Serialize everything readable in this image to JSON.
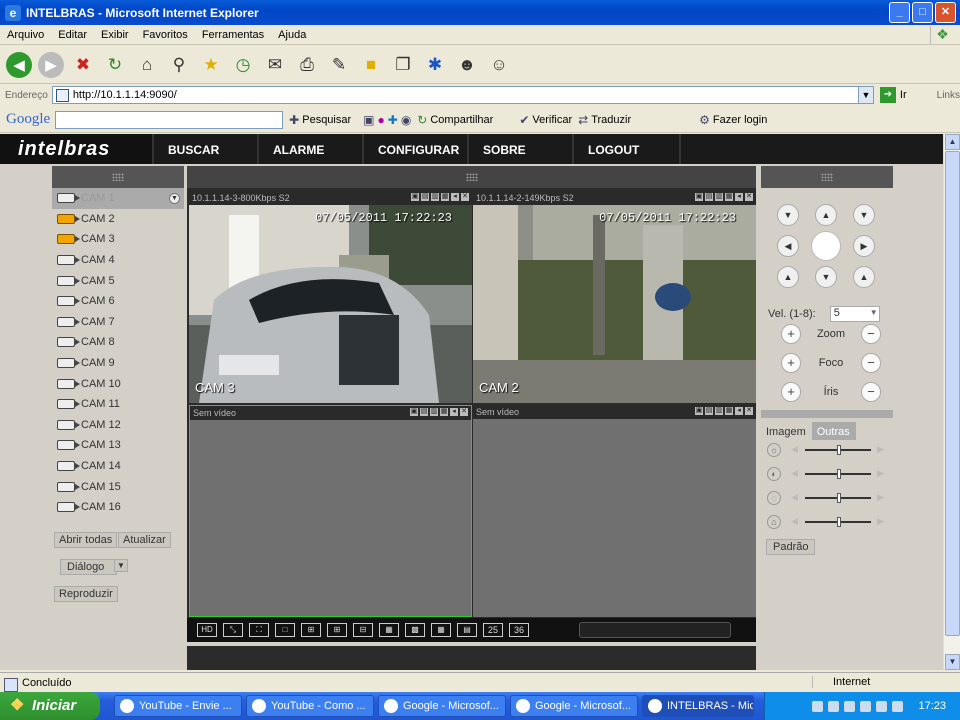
{
  "window": {
    "title": "INTELBRAS - Microsoft Internet Explorer"
  },
  "menu": [
    "Arquivo",
    "Editar",
    "Exibir",
    "Favoritos",
    "Ferramentas",
    "Ajuda"
  ],
  "address": {
    "label": "Endereço",
    "url": "http://10.1.1.14:9090/",
    "go": "Ir",
    "links": "Links"
  },
  "google": {
    "logo": "Google",
    "buttons": [
      "Pesquisar",
      "Compartilhar",
      "Verificar",
      "Traduzir",
      "Fazer login"
    ]
  },
  "app": {
    "brand": "intelbras",
    "nav": [
      "BUSCAR",
      "ALARME",
      "CONFIGURAR",
      "SOBRE",
      "LOGOUT"
    ]
  },
  "cameras": [
    "CAM 1",
    "CAM 2",
    "CAM 3",
    "CAM 4",
    "CAM 5",
    "CAM 6",
    "CAM 7",
    "CAM 8",
    "CAM 9",
    "CAM 10",
    "CAM 11",
    "CAM 12",
    "CAM 13",
    "CAM 14",
    "CAM 15",
    "CAM 16"
  ],
  "left_buttons": {
    "open_all": "Abrir todas",
    "refresh": "Atualizar",
    "dialog": "Diálogo",
    "play": "Reproduzir"
  },
  "video_cells": [
    {
      "title": "10.1.1.14-3-800Kbps S2",
      "timestamp": "07/05/2011  17:22:23",
      "label": "CAM 3"
    },
    {
      "title": "10.1.1.14-2-149Kbps S2",
      "timestamp": "07/05/2011  17:22:23",
      "label": "CAM 2"
    },
    {
      "title": "Sem vídeo",
      "timestamp": "",
      "label": ""
    },
    {
      "title": "Sem vídeo",
      "timestamp": "",
      "label": ""
    }
  ],
  "layout_buttons": [
    "25",
    "36"
  ],
  "ptz": {
    "vel_label": "Vel. (1-8):",
    "vel_value": "5",
    "zoom": "Zoom",
    "foco": "Foco",
    "iris": "Íris"
  },
  "image_tabs": {
    "image": "Imagem",
    "other": "Outras"
  },
  "image_reset": "Padrão",
  "status": {
    "text": "Concluído",
    "zone": "Internet"
  },
  "taskbar": {
    "start": "Iniciar",
    "tasks": [
      "YouTube - Envie ...",
      "YouTube - Como ...",
      "Google - Microsof...",
      "Google - Microsof...",
      "INTELBRAS - Micr..."
    ],
    "clock": "17:23"
  }
}
